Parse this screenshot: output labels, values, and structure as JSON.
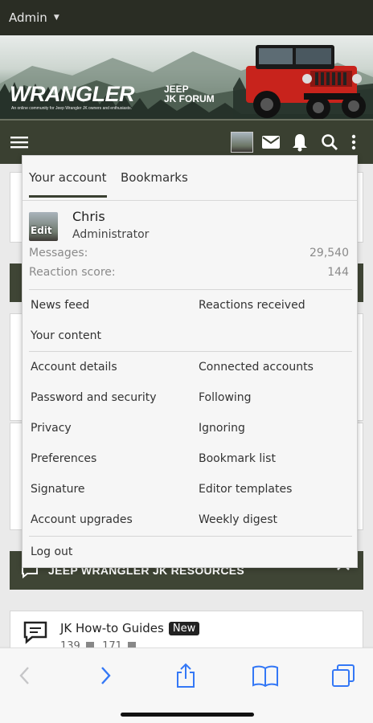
{
  "admin_bar": {
    "label": "Admin"
  },
  "banner": {
    "brand_main": "WRANGLER",
    "brand_small_1": "JEEP",
    "brand_small_2": "JK FORUM",
    "tagline": "An online community for Jeep Wrangler JK owners and enthusiasts."
  },
  "nav": {
    "icons": [
      "menu-icon",
      "avatar",
      "mail-icon",
      "bell-icon",
      "search-icon",
      "more-icon"
    ]
  },
  "dropdown": {
    "tabs": [
      {
        "label": "Your account",
        "active": true
      },
      {
        "label": "Bookmarks",
        "active": false
      }
    ],
    "user": {
      "avatar_label": "Edit",
      "name": "Chris",
      "role": "Administrator",
      "messages_label": "Messages:",
      "messages_value": "29,540",
      "reaction_label": "Reaction score:",
      "reaction_value": "144"
    },
    "links_group1": [
      {
        "label": "News feed"
      },
      {
        "label": "Reactions received"
      },
      {
        "label": "Your content"
      }
    ],
    "links_group2": [
      {
        "label": "Account details"
      },
      {
        "label": "Connected accounts"
      },
      {
        "label": "Password and security"
      },
      {
        "label": "Following"
      },
      {
        "label": "Privacy"
      },
      {
        "label": "Ignoring"
      },
      {
        "label": "Preferences"
      },
      {
        "label": "Bookmark list"
      },
      {
        "label": "Signature"
      },
      {
        "label": "Editor templates"
      },
      {
        "label": "Account upgrades"
      },
      {
        "label": "Weekly digest"
      }
    ],
    "logout": "Log out"
  },
  "page": {
    "resources_section_title": "JEEP WRANGLER JK RESOURCES",
    "resource": {
      "title": "JK How-to Guides",
      "badge": "New",
      "stat1": "139",
      "stat2": "171"
    }
  },
  "toolbar": {
    "icons": [
      "back-icon",
      "forward-icon",
      "share-icon",
      "bookmarks-icon",
      "tabs-icon"
    ]
  },
  "colors": {
    "nav_bg": "#3a4031",
    "admin_bg": "#2a2d24",
    "ios_blue": "#3478f6"
  }
}
